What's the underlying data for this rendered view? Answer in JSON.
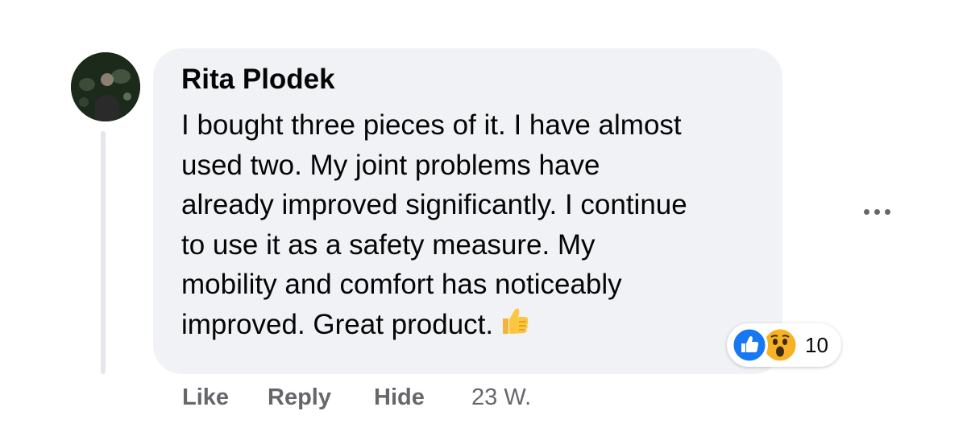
{
  "comment": {
    "author": "Rita Plodek",
    "lines": [
      "I bought three pieces of it. I have almost",
      "used two. My joint problems have",
      "already improved significantly. I continue",
      "to use it as a safety measure. My",
      "mobility and comfort has noticeably",
      "improved. Great product."
    ],
    "inline_emoji": "thumbs-up-emoji",
    "reactions": {
      "icons": [
        "like-icon",
        "wow-icon"
      ],
      "count": "10"
    },
    "actions": {
      "like": "Like",
      "reply": "Reply",
      "hide": "Hide",
      "timestamp": "23 W."
    }
  }
}
